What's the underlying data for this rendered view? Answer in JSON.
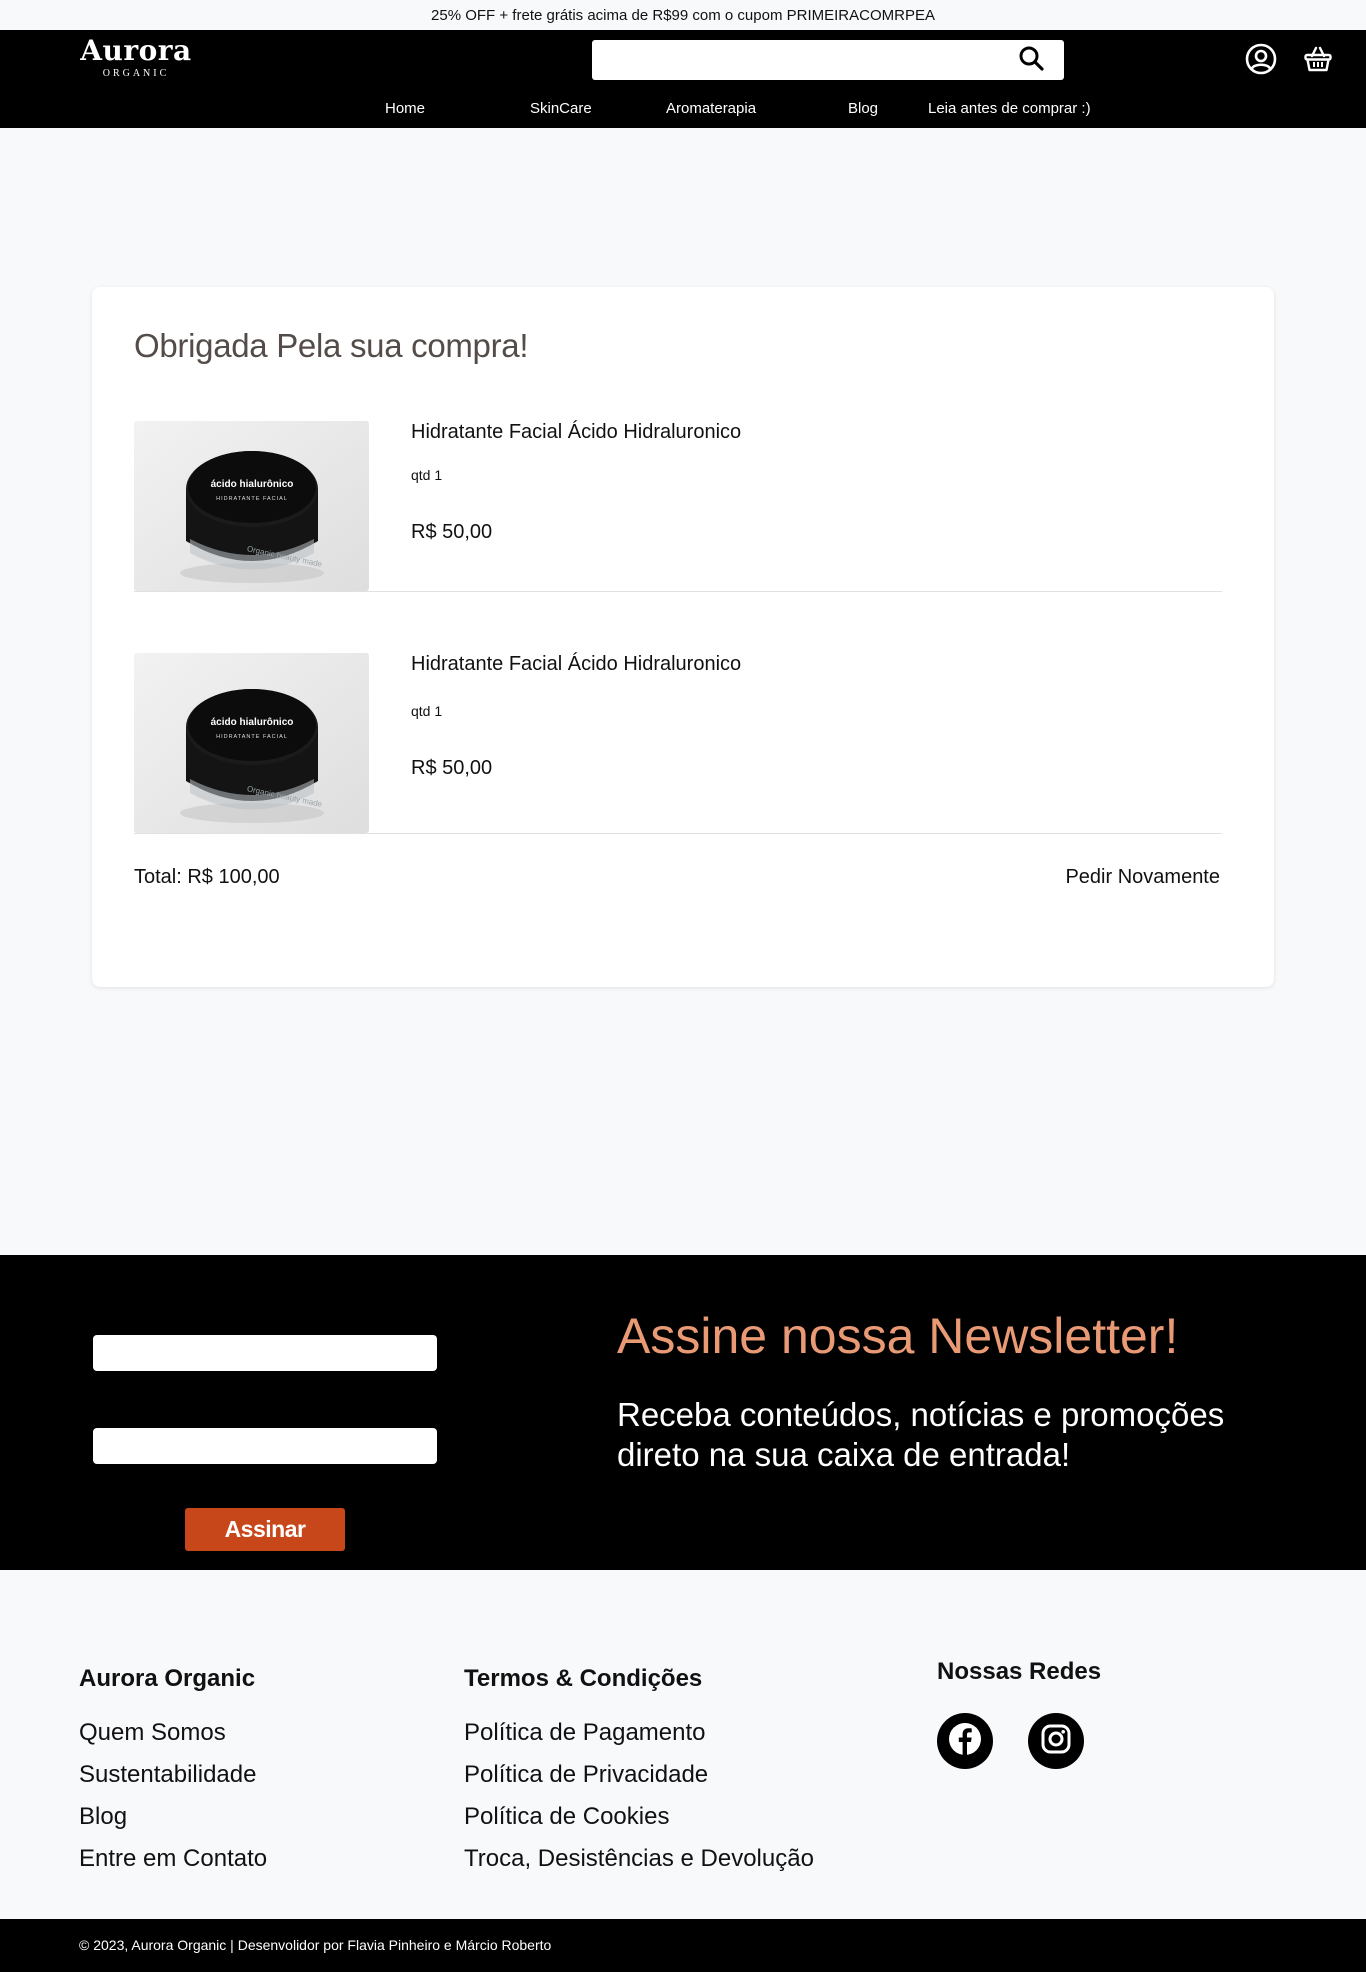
{
  "promo": {
    "text": "25% OFF + frete grátis acima de R$99 com o cupom PRIMEIRACOMRPEA"
  },
  "header": {
    "logo_main": "Aurora",
    "logo_sub": "ORGANIC",
    "search_placeholder": "",
    "icons": [
      "search-icon",
      "user-icon",
      "basket-icon"
    ],
    "nav": [
      "Home",
      "SkinCare",
      "Aromaterapia",
      "Blog",
      "Leia antes de comprar :)"
    ]
  },
  "order": {
    "title": "Obrigada Pela sua compra!",
    "items": [
      {
        "name": "Hidratante Facial Ácido Hidraluronico",
        "qty": "qtd 1",
        "price": "R$ 50,00",
        "jar_label": "ácido hialurônico",
        "jar_sub": "HIDRATANTE FACIAL",
        "jar_brand": "Organic beauty made"
      },
      {
        "name": "Hidratante Facial Ácido Hidraluronico",
        "qty": "qtd 1",
        "price": "R$ 50,00",
        "jar_label": "ácido hialurônico",
        "jar_sub": "HIDRATANTE FACIAL",
        "jar_brand": "Organic beauty made"
      }
    ],
    "total": "Total: R$ 100,00",
    "reorder_label": "Pedir Novamente"
  },
  "newsletter": {
    "title": "Assine nossa Newsletter!",
    "subtitle": "Receba conteúdos, notícias e promoções direto na sua caixa de entrada!",
    "input1_placeholder": "",
    "input2_placeholder": "",
    "button_label": "Assinar"
  },
  "footer": {
    "col1": {
      "heading": "Aurora Organic",
      "links": [
        "Quem Somos",
        "Sustentabilidade",
        "Blog",
        "Entre em Contato"
      ]
    },
    "col2": {
      "heading": "Termos & Condições",
      "links": [
        "Política de Pagamento",
        "Política de Privacidade",
        "Política de Cookies",
        "Troca, Desistências e Devolução"
      ]
    },
    "col3": {
      "heading": "Nossas Redes",
      "icons": [
        "facebook-icon",
        "instagram-icon"
      ]
    },
    "copyright": "© 2023, Aurora Organic | Desenvolidor por Flavia Pinheiro e Márcio Roberto"
  },
  "colors": {
    "header_bg": "#000000",
    "title_text": "#544c48",
    "newsletter_title": "#e99a75",
    "button_bg": "#c8471a",
    "page_bg": "#f8f9fb"
  }
}
